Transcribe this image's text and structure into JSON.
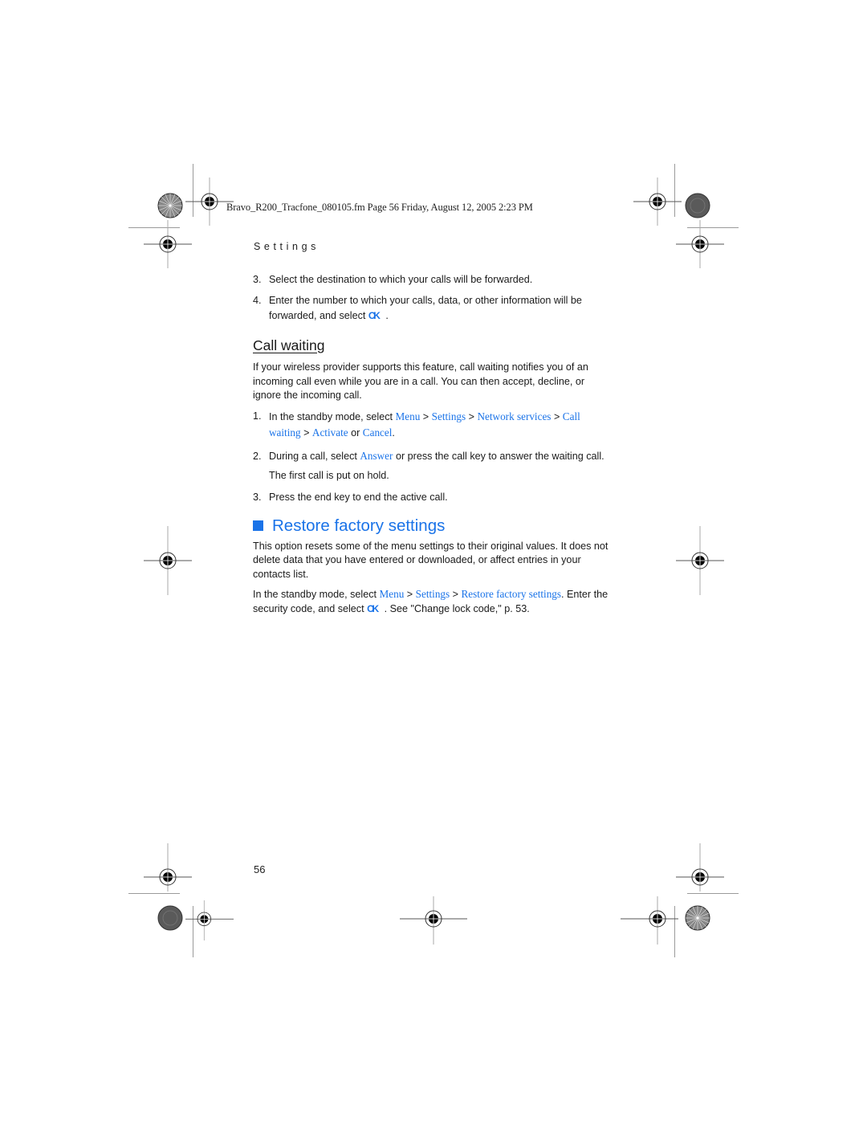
{
  "header": {
    "file_line": "Bravo_R200_Tracfone_080105.fm  Page 56  Friday, August 12, 2005  2:23 PM",
    "running_title": "Settings"
  },
  "forwarding_steps": [
    {
      "num": "3.",
      "text": "Select the destination to which your calls will be forwarded."
    },
    {
      "num": "4.",
      "text_before": "Enter the number to which your calls, data, or other information will be forwarded, and select",
      "ok_glyph": "OK",
      "text_after": "."
    }
  ],
  "call_waiting": {
    "heading": "Call waiting",
    "intro": "If your wireless provider supports this feature, call waiting notifies you of an incoming call even while you are in a call. You can then accept, decline, or ignore the incoming call.",
    "steps": [
      {
        "num": "1.",
        "text_before": "In the standby mode, select",
        "menu": "Menu",
        "sep": ">",
        "settings": "Settings",
        "network": "Network services",
        "call_waiting": "Call waiting",
        "activate": "Activate",
        "or": "or",
        "cancel": "Cancel",
        "end": "."
      },
      {
        "num": "2.",
        "text_before": "During a call, select",
        "answer": "Answer",
        "text_after": "or press the call key to answer the waiting call.",
        "line2": "The first call is put on hold."
      },
      {
        "num": "3.",
        "text": "Press the end key to end the active call."
      }
    ]
  },
  "restore": {
    "heading": "Restore factory settings",
    "intro": "This option resets some of the menu settings to their original values. It does not delete data that you have entered or downloaded, or affect entries in your contacts list.",
    "text_before": "In the standby mode, select",
    "menu": "Menu",
    "sep": ">",
    "settings": "Settings",
    "restore_item": "Restore factory settings",
    "text_mid": ". Enter the security code, and select",
    "ok_glyph": "OK",
    "text_after": ". See \"Change lock code,\" p. 53."
  },
  "footer": {
    "page_number": "56"
  },
  "colors": {
    "accent_blue": "#1a73e8",
    "text": "#1a1a1a"
  }
}
